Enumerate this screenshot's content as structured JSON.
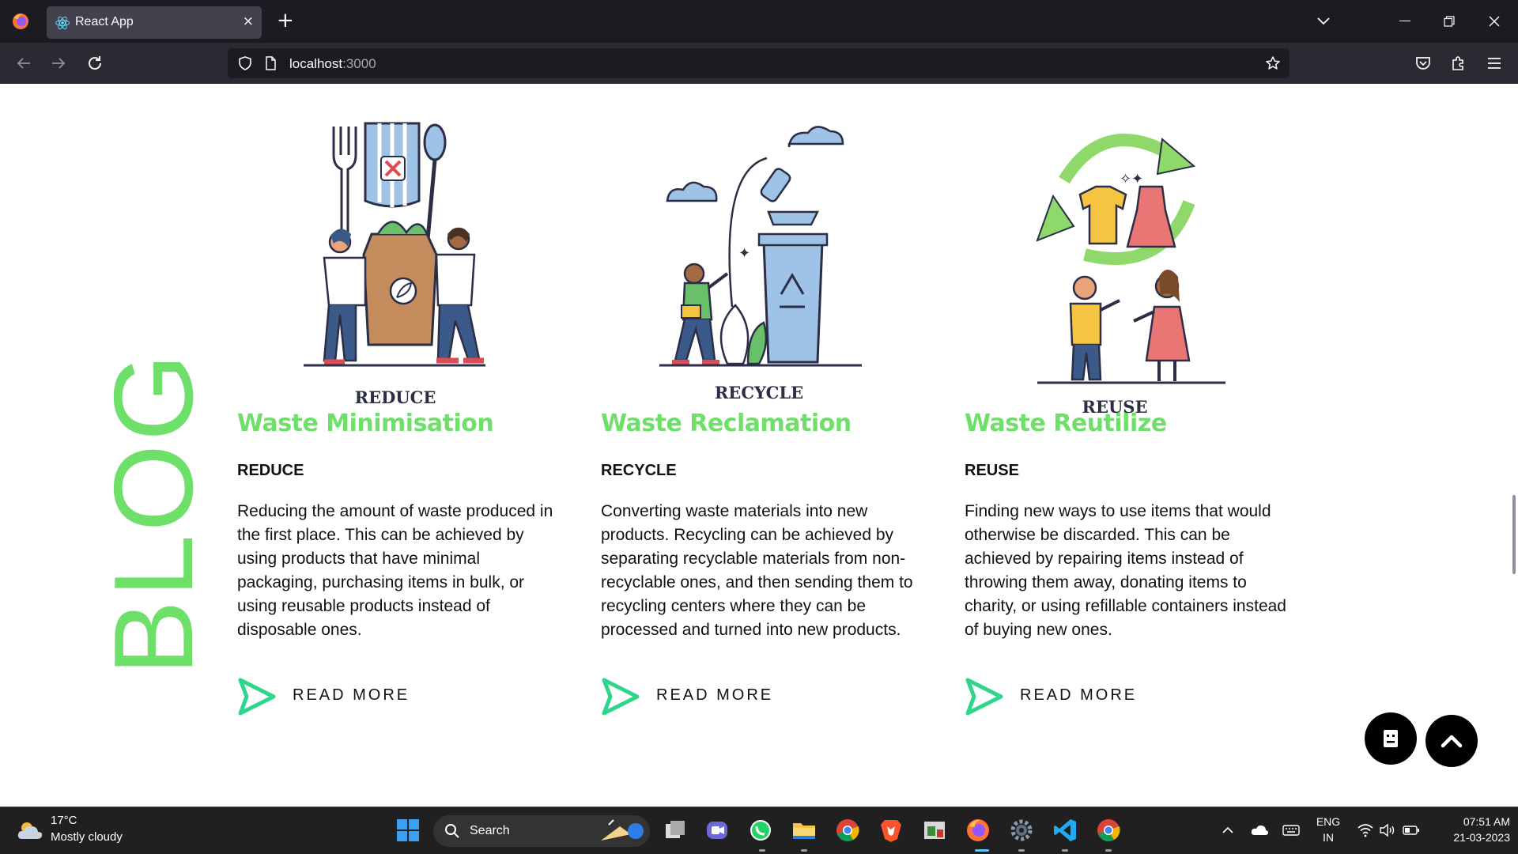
{
  "browser": {
    "tab_title": "React App",
    "url_host": "localhost",
    "url_port": ":3000",
    "tab_close_glyph": "×",
    "new_tab_glyph": "+"
  },
  "page": {
    "side_label": "BLOG",
    "cards": [
      {
        "image_caption": "REDUCE",
        "title": "Waste Minimisation",
        "subtitle": "REDUCE",
        "body": "Reducing the amount of waste produced in the first place. This can be achieved by using products that have minimal packaging, purchasing items in bulk, or using reusable products instead of disposable ones.",
        "link": "READ MORE"
      },
      {
        "image_caption": "RECYCLE",
        "title": "Waste Reclamation",
        "subtitle": "RECYCLE",
        "body": "Converting waste materials into new products. Recycling can be achieved by separating recyclable materials from non-recyclable ones, and then sending them to recycling centers where they can be processed and turned into new products.",
        "link": "READ MORE"
      },
      {
        "image_caption": "REUSE",
        "title": "Waste Reutilize",
        "subtitle": "REUSE",
        "body": "Finding new ways to use items that would otherwise be discarded. This can be achieved by repairing items instead of throwing them away, donating items to charity, or using refillable containers instead of buying new ones.",
        "link": "READ MORE"
      }
    ],
    "accent_color": "#6ee06a",
    "arrow_color": "#2fd58a"
  },
  "taskbar": {
    "weather_temp": "17°C",
    "weather_desc": "Mostly cloudy",
    "search_label": "Search",
    "lang_top": "ENG",
    "lang_bottom": "IN",
    "time": "07:51 AM",
    "date": "21-03-2023",
    "pinned_apps": [
      "start-icon",
      "search-icon",
      "task-view-icon",
      "meet-icon",
      "whatsapp-icon",
      "file-explorer-icon",
      "chrome-icon",
      "brave-icon",
      "app-icon",
      "firefox-icon",
      "settings-icon",
      "vscode-icon",
      "chrome-icon"
    ]
  }
}
